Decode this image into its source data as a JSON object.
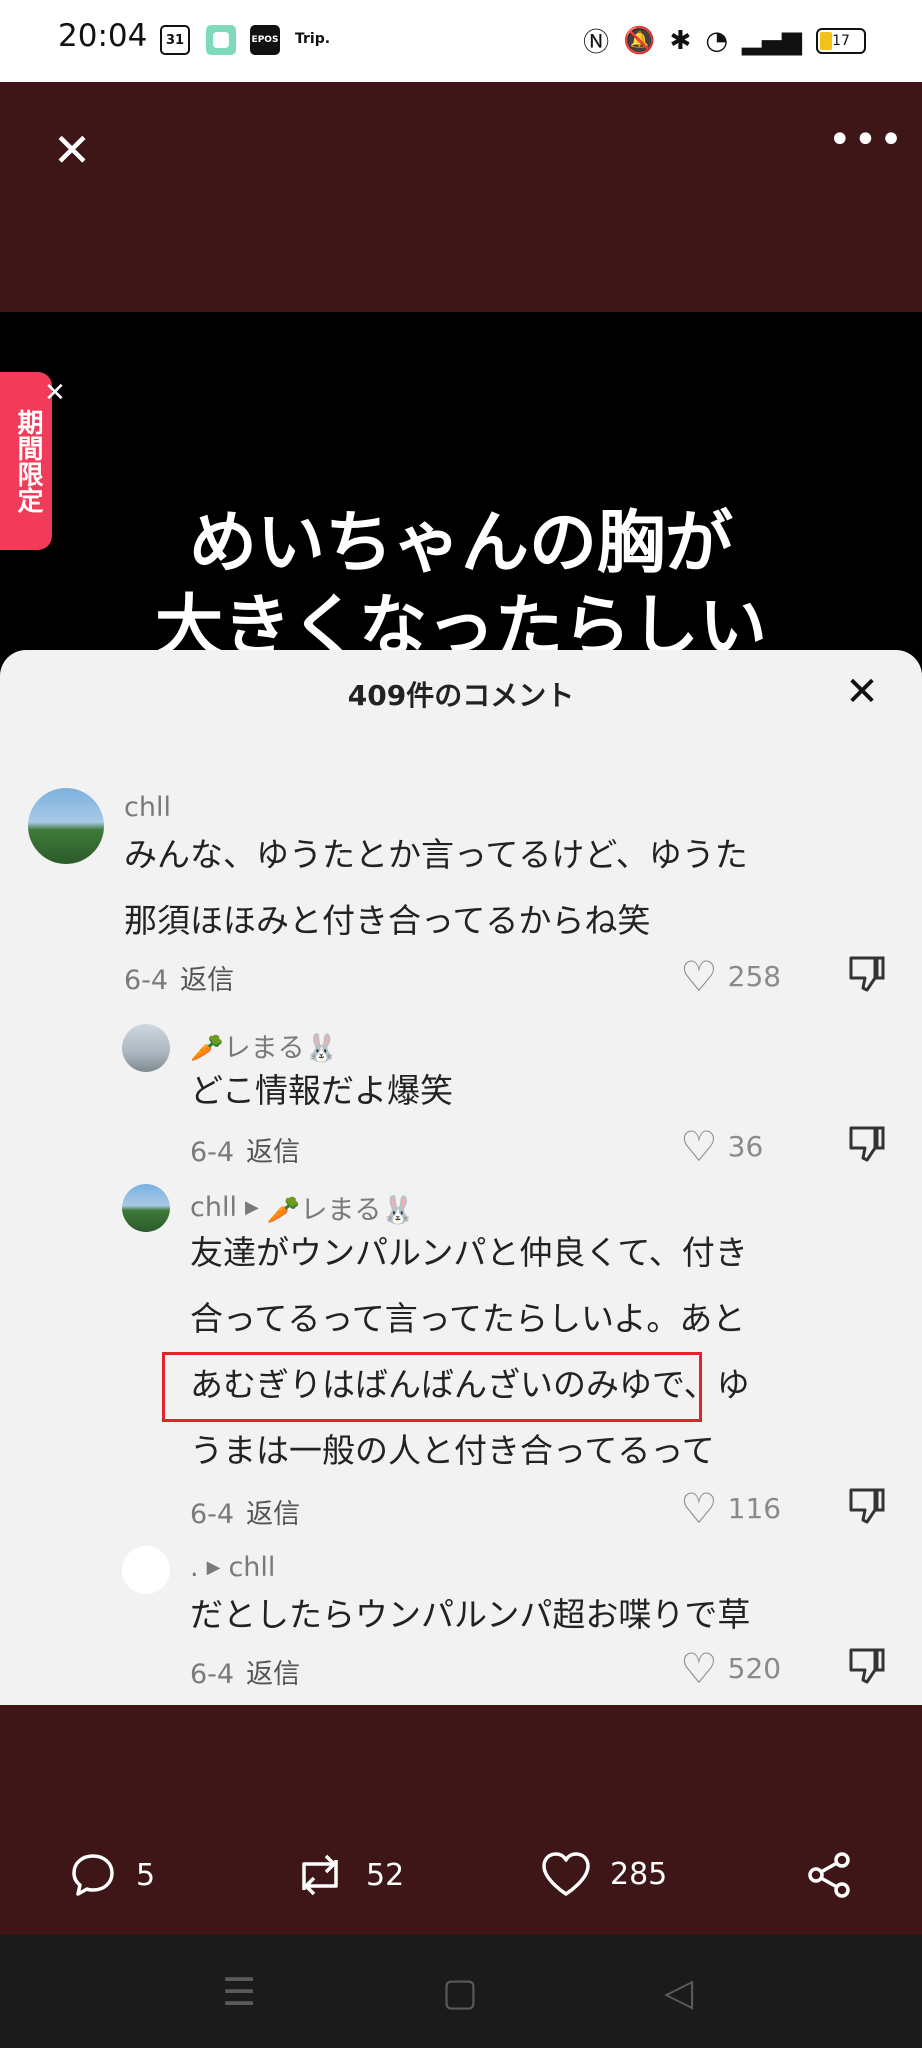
{
  "status": {
    "time": "20:04",
    "apps": [
      "31",
      "",
      "EPOS",
      "Trip."
    ],
    "battery": "17"
  },
  "video": {
    "caption_line1": "めいちゃんの胸が",
    "caption_line2": "大きくなったらしい",
    "promo": "期間限定"
  },
  "comments": {
    "title": "409件のコメント",
    "reply_label": "返信",
    "items": [
      {
        "user": "chll",
        "text_line1": "みんな、ゆうたとか言ってるけど、ゆうた",
        "text_line2": "那須ほほみと付き合ってるからね笑",
        "date": "6-4",
        "likes": "258"
      },
      {
        "user": "🥕レまる🐰",
        "text_line1": "どこ情報だよ爆笑",
        "date": "6-4",
        "likes": "36"
      },
      {
        "user": "chll",
        "reply_to": "🥕レまる🐰",
        "text_line1": "友達がウンパルンパと仲良くて、付き",
        "text_line2": "合ってるって言ってたらしいよ。あと",
        "text_line3": "あむぎりはばんばんざいのみゆで、ゆ",
        "text_line4": "うまは一般の人と付き合ってるって",
        "date": "6-4",
        "likes": "116"
      },
      {
        "user": ".",
        "reply_to": "chll",
        "text_line1": "だとしたらウンパルンパ超お喋りで草",
        "date": "6-4",
        "likes": "520"
      }
    ]
  },
  "actions": {
    "comments": "5",
    "reposts": "52",
    "likes": "285"
  }
}
